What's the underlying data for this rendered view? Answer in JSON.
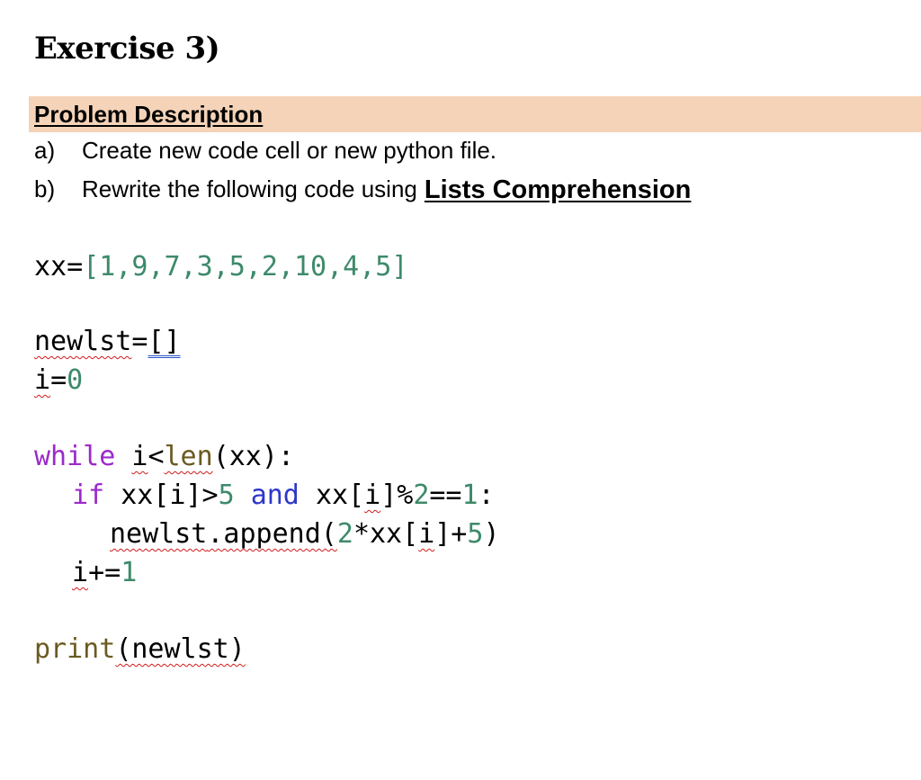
{
  "exercise": {
    "title": "Exercise 3)"
  },
  "problem": {
    "heading": "Problem Description",
    "steps": [
      {
        "marker": "a)",
        "text": "Create new code cell or new python file."
      },
      {
        "marker": "b)",
        "text": "Rewrite the following code using",
        "emphasis": "Lists Comprehension"
      }
    ]
  },
  "code": {
    "line1": {
      "var": "xx",
      "op": "=",
      "open": "[",
      "values": "1,9,7,3,5,2,10,4,5",
      "close": "]"
    },
    "line2": {
      "var": "newlst",
      "op": "=",
      "list": "[]"
    },
    "line3": {
      "var": "i",
      "op": "=",
      "value": "0"
    },
    "line4": {
      "kw": "while",
      "cond_var": "i",
      "lt": "<",
      "fn": "len",
      "arg": "(xx)",
      "colon": ":"
    },
    "line5": {
      "kw": "if",
      "a": "xx[i]>",
      "n5": "5",
      "and": "and",
      "b": "xx[",
      "b_i": "i",
      "b2": "]%",
      "n2": "2",
      "eq": "==",
      "n1": "1",
      "colon": ":"
    },
    "line6": {
      "obj": "newlst",
      "method": ".append(",
      "n2": "2",
      "mul": "*xx[",
      "idx": "i",
      "plus": "]+",
      "n5": "5",
      "close": ")"
    },
    "line7": {
      "var": "i",
      "op": "+=",
      "value": "1"
    },
    "line8": {
      "fn": "print",
      "arg": "(newlst)"
    }
  },
  "colors": {
    "highlight": "#f4d3b8",
    "number": "#3d8a6a",
    "keyword": "#9b2ac9",
    "keyword_and": "#2e37c8",
    "builtin": "#6b5a21",
    "spell_error": "#d21a1a"
  }
}
